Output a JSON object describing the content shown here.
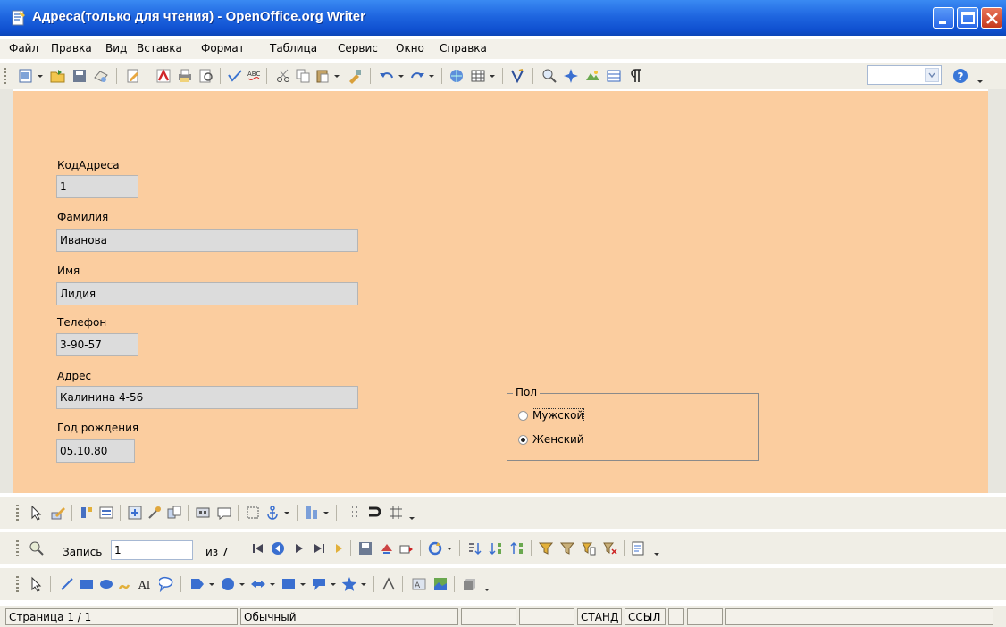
{
  "window": {
    "title": "Адреса(только для чтения) - OpenOffice.org Writer"
  },
  "menu": [
    "Файл",
    "Правка",
    "Вид",
    "Вставка",
    "Формат",
    "Таблица",
    "Сервис",
    "Окно",
    "Справка"
  ],
  "form": {
    "kod_label": "КодАдреса",
    "kod_value": "1",
    "familiya_label": "Фамилия",
    "familiya_value": "Иванова",
    "imya_label": "Имя",
    "imya_value": "Лидия",
    "telefon_label": "Телефон",
    "telefon_value": "3-90-57",
    "adres_label": "Адрес",
    "adres_value": "Калинина 4-56",
    "god_label": "Год рождения",
    "god_value": "05.10.80",
    "pol_title": "Пол",
    "pol_male": "Мужской",
    "pol_female": "Женский",
    "pol_selected": "Женский"
  },
  "navigation": {
    "record_label": "Запись",
    "record_value": "1",
    "of_label": "из 7"
  },
  "status": {
    "page": "Страница  1 / 1",
    "style": "Обычный",
    "mode": "СТАНД",
    "link": "ССЫЛ"
  },
  "colors": {
    "document_background": "#fbcd9f",
    "titlebar": "#1f66e0",
    "field_background": "#dcdcdc"
  }
}
